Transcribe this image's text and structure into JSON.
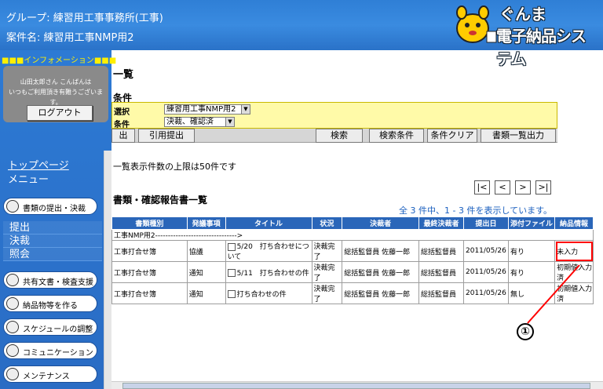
{
  "header": {
    "group": "グループ: 練習用工事事務所(工事)",
    "case": "案件名: 練習用工事NMP用2",
    "logo_line1": "ぐんま",
    "logo_line2": "電子納品システム"
  },
  "sidebar": {
    "info_heading": "■■■インフォメーション■■■",
    "greeting": "山田太郎さん こんばんは\nいつもご利用頂き有難うございます。",
    "logout": "ログアウト",
    "top_page": "トップページ",
    "menu": "メニュー",
    "items": [
      {
        "label": "書類の提出・決裁",
        "icon": "document-icon"
      },
      {
        "label": "共有文書・検査支援",
        "icon": "document-icon"
      },
      {
        "label": "納品物等を作る",
        "icon": "folder-icon"
      },
      {
        "label": "スケジュールの調整",
        "icon": "calendar-icon"
      },
      {
        "label": "コミュニケーション",
        "icon": "chat-icon"
      },
      {
        "label": "メンテナンス",
        "icon": "wrench-icon"
      }
    ],
    "submenu": [
      "提出",
      "決裁",
      "照会"
    ]
  },
  "main": {
    "title": "一覧",
    "cond_title": "条件",
    "cond_label1": "選択",
    "cond_label2": "条件",
    "select1": "練習用工事NMP用2",
    "select2": "決裁、確認済",
    "buttons": [
      "出",
      "引用提出",
      "検索",
      "検索条件",
      "条件クリア",
      "書類一覧出力"
    ],
    "notice": "一覧表示件数の上限は50件です",
    "list_title": "書類・確認報告書一覧",
    "pager": [
      "|<",
      "<",
      ">",
      ">|"
    ],
    "count": "全 3 件中、1 - 3 件を表示しています。",
    "columns": [
      "書類種別",
      "発議事項",
      "タイトル",
      "状況",
      "決裁者",
      "最終決裁者",
      "提出日",
      "添付ファイル",
      "納品情報"
    ],
    "group_row": "工事NMP用2-------------------------------->",
    "rows": [
      {
        "type": "工事打合せ簿",
        "issue": "協議",
        "title": "5/20　打ち合わせについて",
        "status": "決裁完了",
        "approver": "総括監督員 佐藤一郎",
        "final": "総括監督員",
        "date": "2011/05/26",
        "attach": "有り",
        "delivery": "未入力"
      },
      {
        "type": "工事打合せ簿",
        "issue": "通知",
        "title": "5/11　打ち合わせの件",
        "status": "決裁完了",
        "approver": "総括監督員 佐藤一郎",
        "final": "総括監督員",
        "date": "2011/05/26",
        "attach": "有り",
        "delivery": "初期値入力済"
      },
      {
        "type": "工事打合せ簿",
        "issue": "通知",
        "title": "打ち合わせの件",
        "status": "決裁完了",
        "approver": "総括監督員 佐藤一郎",
        "final": "総括監督員",
        "date": "2011/05/26",
        "attach": "無し",
        "delivery": "初期値入力済"
      }
    ]
  },
  "annotation": "①",
  "colors": {
    "header_blue": "#2f7fd6",
    "table_head": "#2a66b9",
    "cond_yellow": "#fffaa8",
    "highlight": "#ff0000"
  }
}
